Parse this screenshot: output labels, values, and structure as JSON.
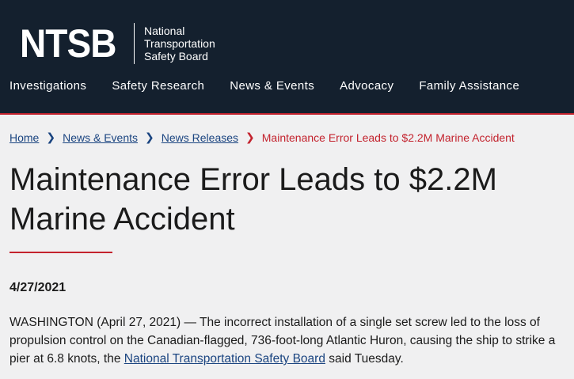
{
  "header": {
    "logo_mark": "NTSB",
    "logo_lines": [
      "National",
      "Transportation",
      "Safety Board"
    ],
    "nav": [
      "Investigations",
      "Safety Research",
      "News & Events",
      "Advocacy",
      "Family Assistance"
    ]
  },
  "breadcrumb": {
    "items": [
      "Home",
      "News & Events",
      "News Releases"
    ],
    "current": "Maintenance Error Leads to $2.2M Marine Accident"
  },
  "article": {
    "title": "Maintenance Error Leads to $2.2M Marine Accident",
    "date": "4/27/2021",
    "body_before": "WASHINGTON (April 27, 2021) — The incorrect installation of a single set screw led to the loss of propulsion control on the Canadian-flagged, 736-foot-long Atlantic Huron, causing the ship to strike a pier at 6.8 knots, the ",
    "body_link": "National Transportation Safety Board",
    "body_after": " said Tuesday."
  },
  "colors": {
    "header_bg": "#14202e",
    "accent_red": "#c3222d",
    "link_blue": "#1a4480",
    "page_bg": "#f0f0f1"
  }
}
